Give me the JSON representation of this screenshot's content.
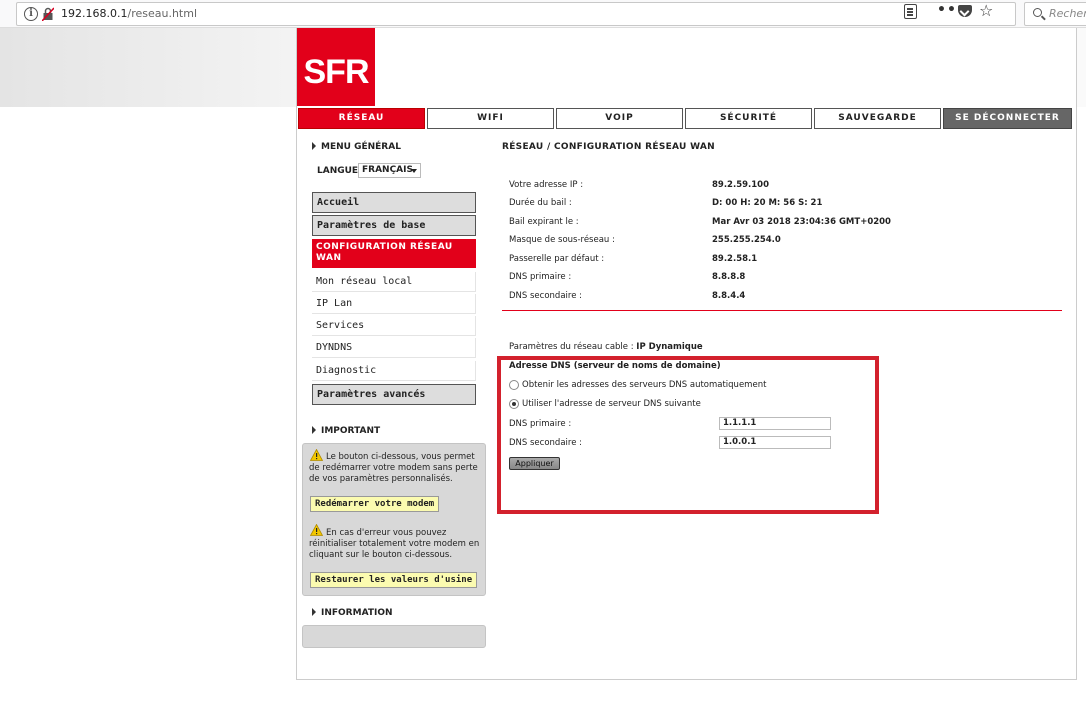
{
  "browser": {
    "url_host": "192.168.0.1",
    "url_path": "/reseau.html",
    "search_placeholder": "Recherc",
    "more_label": "•••"
  },
  "logo": {
    "text": "SFR",
    "color": "#e2001a"
  },
  "tabs": [
    {
      "label": "RÉSEAU",
      "active": true
    },
    {
      "label": "WIFI"
    },
    {
      "label": "VOIP"
    },
    {
      "label": "SÉCURITÉ"
    },
    {
      "label": "SAUVEGARDE"
    },
    {
      "label": "SE DÉCONNECTER"
    }
  ],
  "sidebar": {
    "menu_general": "MENU GÉNÉRAL",
    "langue_label": "LANGUE",
    "langue_value": "FRANÇAIS",
    "items": [
      {
        "label": "Accueil"
      },
      {
        "label": "Paramètres de base"
      },
      {
        "label": "CONFIGURATION RÉSEAU WAN",
        "active": true
      },
      {
        "label": "Mon réseau local"
      },
      {
        "label": "IP Lan"
      },
      {
        "label": "Services"
      },
      {
        "label": "DYNDNS"
      },
      {
        "label": "Diagnostic"
      },
      {
        "label": "Paramètres avancés"
      }
    ],
    "important_heading": "IMPORTANT",
    "important_text_1": "Le bouton ci-dessous, vous permet de redémarrer votre modem sans perte de vos paramètres personnalisés.",
    "restart_button": "Redémarrer votre modem",
    "important_text_2": "En cas d'erreur vous pouvez réinitialiser totalement votre modem en cliquant sur le bouton ci-dessous.",
    "factory_button": "Restaurer les valeurs d'usine",
    "information_heading": "INFORMATION"
  },
  "main": {
    "title": "RÉSEAU / CONFIGURATION RÉSEAU WAN",
    "info_rows": [
      {
        "label": "Votre adresse IP :",
        "value": "89.2.59.100"
      },
      {
        "label": "Durée du bail :",
        "value": "D: 00 H: 20 M: 56 S: 21"
      },
      {
        "label": "Bail expirant le :",
        "value": "Mar Avr 03 2018 23:04:36 GMT+0200"
      },
      {
        "label": "Masque de sous-réseau :",
        "value": "255.255.254.0"
      },
      {
        "label": "Passerelle par défaut :",
        "value": "89.2.58.1"
      },
      {
        "label": "DNS primaire :",
        "value": "8.8.8.8"
      },
      {
        "label": "DNS secondaire :",
        "value": "8.8.4.4"
      }
    ],
    "cable_label": "Paramètres du réseau cable :",
    "cable_value": "IP Dynamique",
    "dns_title": "Adresse DNS (serveur de noms de domaine)",
    "radio_auto": "Obtenir les adresses des serveurs DNS automatiquement",
    "radio_manual": "Utiliser l'adresse de serveur DNS suivante",
    "radio_selected": "manual",
    "dns_primary_label": "DNS primaire :",
    "dns_primary_value": "1.1.1.1",
    "dns_secondary_label": "DNS secondaire :",
    "dns_secondary_value": "1.0.0.1",
    "apply_button": "Appliquer",
    "highlight_color": "#d3212d"
  }
}
